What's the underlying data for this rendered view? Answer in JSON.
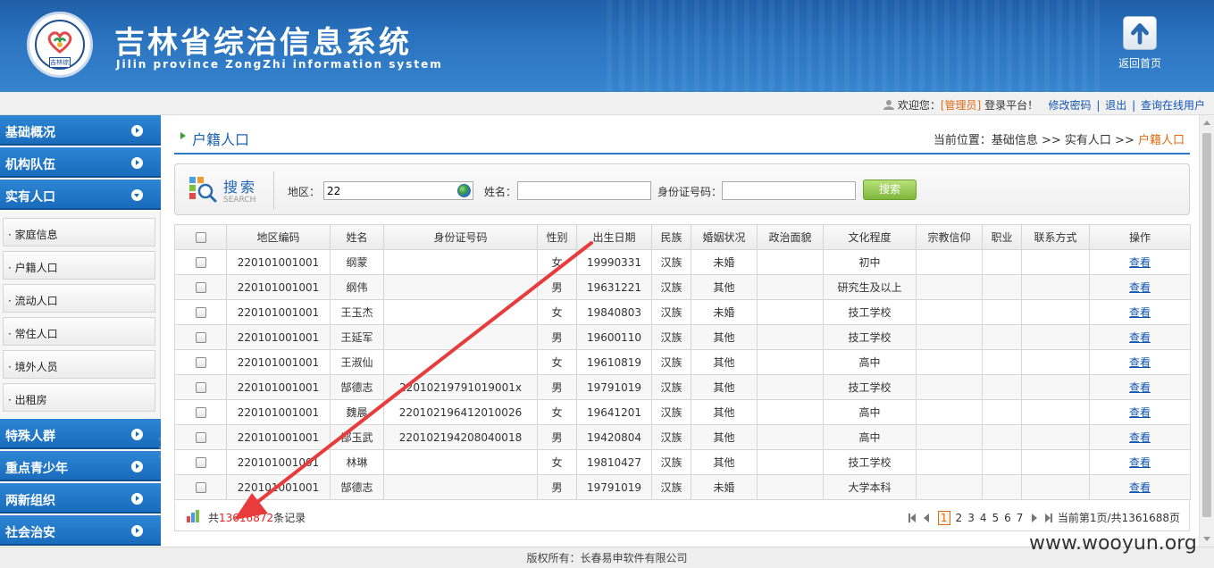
{
  "header": {
    "title": "吉林省综治信息系统",
    "subtitle": "Jilin province ZongZhi information system",
    "logo_text": "吉林综治",
    "home_label": "返回首页"
  },
  "userbar": {
    "welcome": "欢迎您：",
    "role": "[管理员]",
    "login_text": "登录平台！",
    "change_password": "修改密码",
    "logout": "退出",
    "online_users": "查询在线用户",
    "separator": "|"
  },
  "sidebar": {
    "top_items": [
      "基础概况",
      "机构队伍",
      "实有人口"
    ],
    "sub_items": [
      "家庭信息",
      "户籍人口",
      "流动人口",
      "常住人口",
      "境外人员",
      "出租房"
    ],
    "bottom_items": [
      "特殊人群",
      "重点青少年",
      "两新组织",
      "社会治安"
    ]
  },
  "page": {
    "title": "户籍人口",
    "breadcrumb_prefix": "当前位置：基础信息 >> 实有人口 >> ",
    "breadcrumb_current": "户籍人口"
  },
  "search": {
    "title": "搜索",
    "title_en": "SEARCH",
    "region_label": "地区：",
    "region_value": "22",
    "name_label": "姓名：",
    "name_value": "",
    "id_label": "身份证号码：",
    "id_value": "",
    "button": "搜索"
  },
  "table": {
    "headers": [
      "",
      "地区编码",
      "姓名",
      "身份证号码",
      "性别",
      "出生日期",
      "民族",
      "婚姻状况",
      "政治面貌",
      "文化程度",
      "宗教信仰",
      "职业",
      "联系方式",
      "操作"
    ],
    "rows": [
      [
        "220101001001",
        "纲蒙",
        "",
        "女",
        "19990331",
        "汉族",
        "未婚",
        "",
        "初中",
        "",
        "",
        "",
        "查看"
      ],
      [
        "220101001001",
        "纲伟",
        "",
        "男",
        "19631221",
        "汉族",
        "其他",
        "",
        "研究生及以上",
        "",
        "",
        "",
        "查看"
      ],
      [
        "220101001001",
        "王玉杰",
        "",
        "女",
        "19840803",
        "汉族",
        "未婚",
        "",
        "技工学校",
        "",
        "",
        "",
        "查看"
      ],
      [
        "220101001001",
        "王延军",
        "",
        "男",
        "19600110",
        "汉族",
        "其他",
        "",
        "技工学校",
        "",
        "",
        "",
        "查看"
      ],
      [
        "220101001001",
        "王淑仙",
        "",
        "女",
        "19610819",
        "汉族",
        "其他",
        "",
        "高中",
        "",
        "",
        "",
        "查看"
      ],
      [
        "220101001001",
        "郜德志",
        "22010219791019001x",
        "男",
        "19791019",
        "汉族",
        "其他",
        "",
        "技工学校",
        "",
        "",
        "",
        "查看"
      ],
      [
        "220101001001",
        "魏晨",
        "220102196412010026",
        "女",
        "19641201",
        "汉族",
        "其他",
        "",
        "高中",
        "",
        "",
        "",
        "查看"
      ],
      [
        "220101001001",
        "郜玉武",
        "220102194208040018",
        "男",
        "19420804",
        "汉族",
        "其他",
        "",
        "高中",
        "",
        "",
        "",
        "查看"
      ],
      [
        "220101001001",
        "林琳",
        "",
        "女",
        "19810427",
        "汉族",
        "其他",
        "",
        "技工学校",
        "",
        "",
        "",
        "查看"
      ],
      [
        "220101001001",
        "郜德志",
        "",
        "男",
        "19791019",
        "汉族",
        "未婚",
        "",
        "大学本科",
        "",
        "",
        "",
        "查看"
      ]
    ]
  },
  "footer": {
    "record_prefix": "共",
    "record_count": "13616872",
    "record_suffix": "条记录",
    "pages": [
      "1",
      "2",
      "3",
      "4",
      "5",
      "6",
      "7"
    ],
    "active_page": "1",
    "page_info": "当前第1页/共1361688页"
  },
  "copyright": "版权所有：长春易申软件有限公司",
  "watermark": "www.wooyun.org",
  "colors": {
    "header_blue": "#2b74c0",
    "nav_blue": "#1a6cbd",
    "accent_orange": "#e06b14",
    "link_blue": "#1155b3",
    "search_green": "#7eb73d",
    "annotation_red": "#e83b3b"
  }
}
